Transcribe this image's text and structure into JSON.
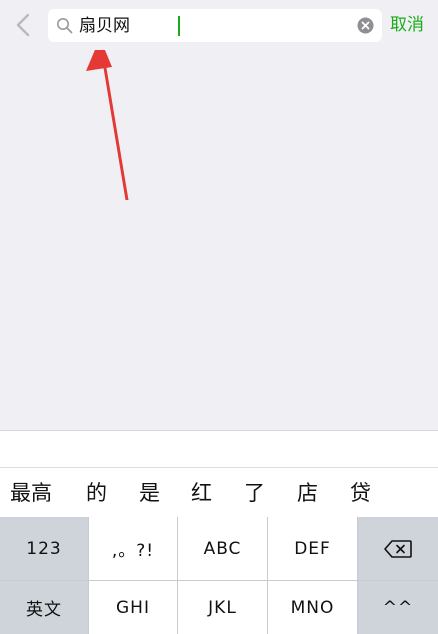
{
  "search": {
    "query": "扇贝网",
    "cancel_label": "取消"
  },
  "candidates": [
    "最高",
    "的",
    "是",
    "红",
    "了",
    "店",
    "贷"
  ],
  "keyboard": {
    "row1": [
      "123",
      ",。?!",
      "ABC",
      "DEF"
    ],
    "row2": [
      "英文",
      "GHI",
      "JKL",
      "MNO",
      "^^"
    ]
  },
  "icons": {
    "back": "chevron-left-icon",
    "search": "search-icon",
    "clear": "clear-icon",
    "backspace": "backspace-icon"
  },
  "colors": {
    "accent": "#1aad19",
    "annotation": "#e53935",
    "background": "#efeff4"
  }
}
